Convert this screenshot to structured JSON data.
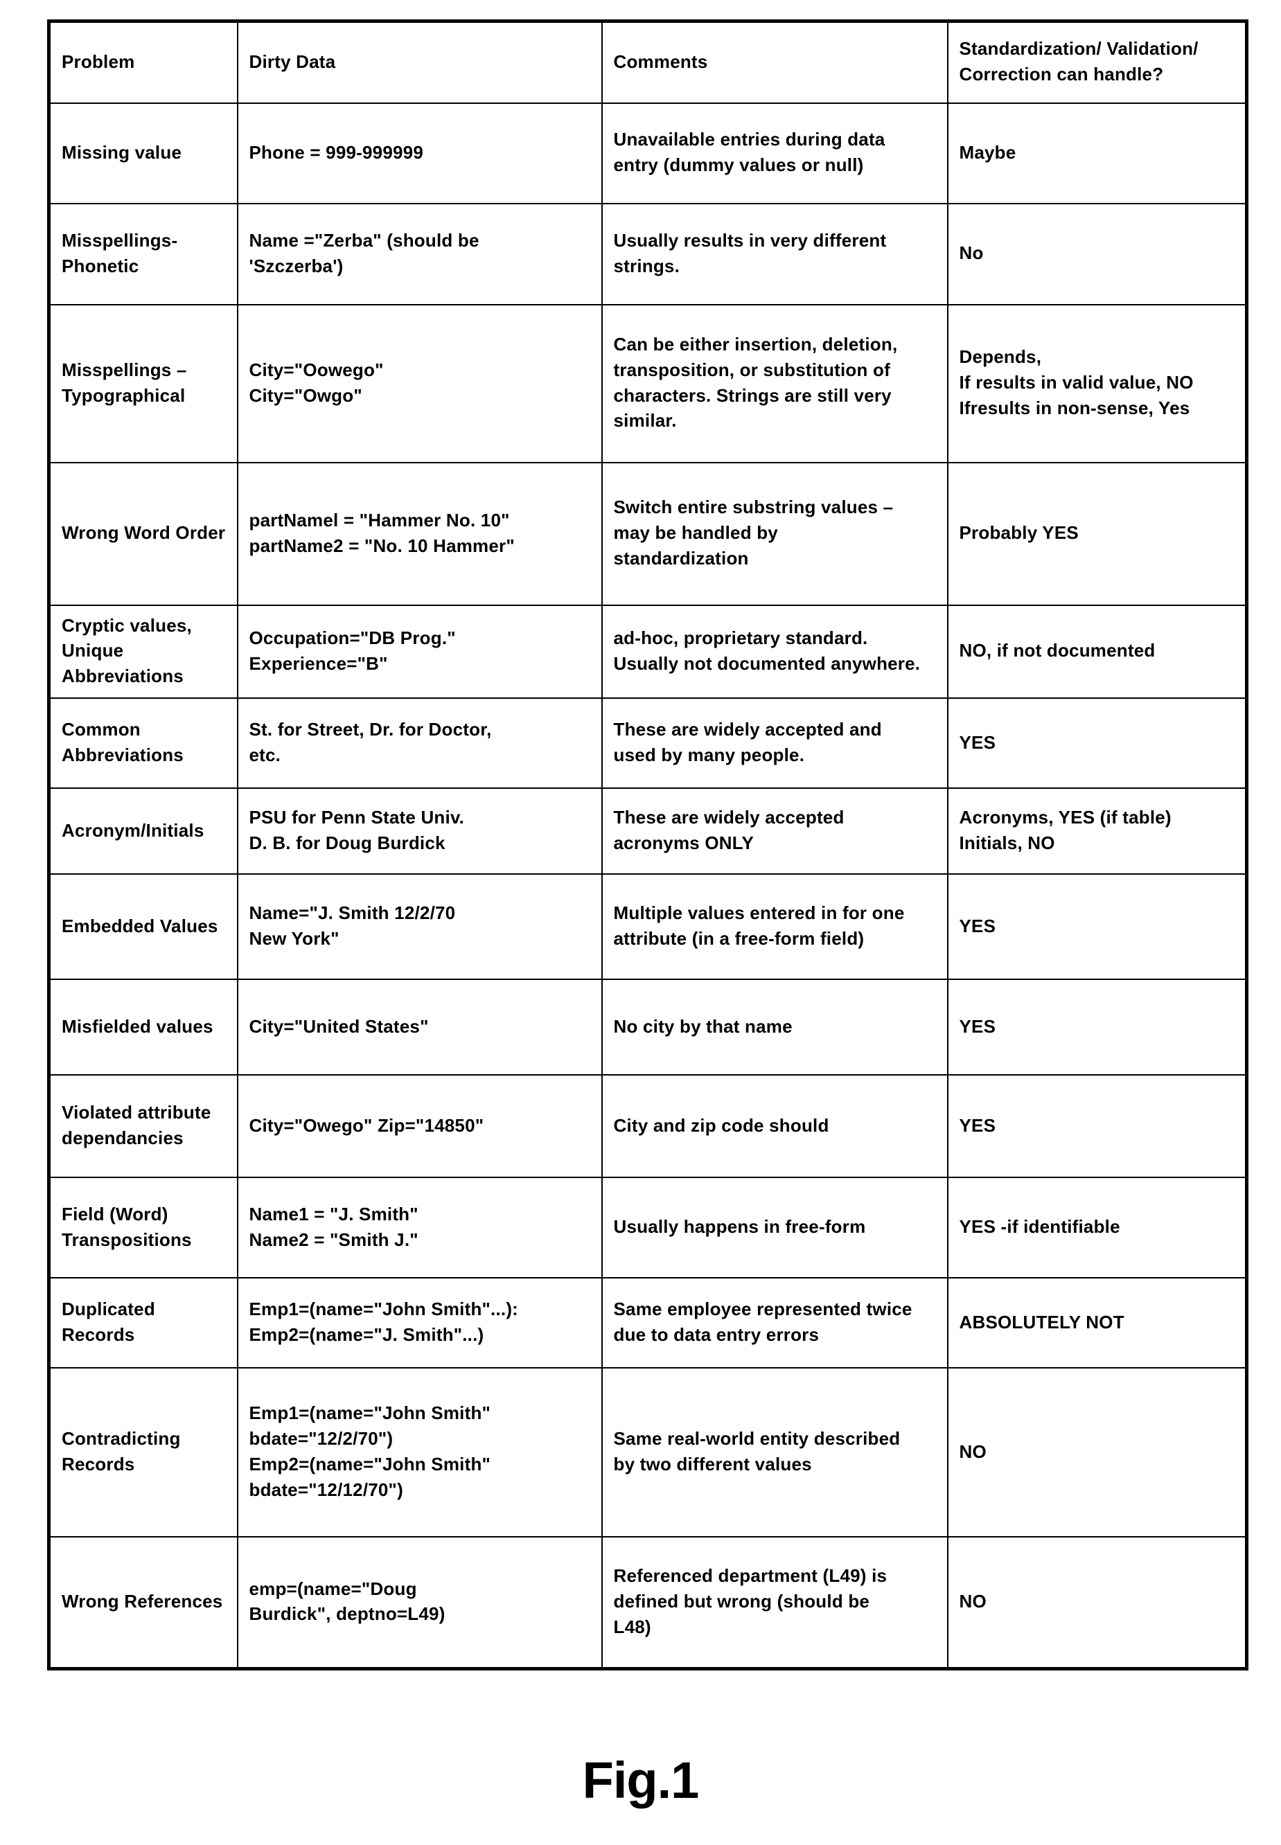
{
  "figure": {
    "caption": "Fig.1"
  },
  "table": {
    "columns": [
      "Problem",
      "Dirty Data",
      "Comments",
      "Standardization/ Validation/\nCorrection can handle?"
    ],
    "rows": [
      {
        "problem": "Missing value",
        "dirty_data": "Phone = 999-999999",
        "comments": "Unavailable entries during data\nentry (dummy values or null)",
        "handle": "Maybe"
      },
      {
        "problem": "Misspellings-\nPhonetic",
        "dirty_data": "Name =\"Zerba\" (should be\n'Szczerba')",
        "comments": "Usually results in very different\nstrings.",
        "handle": "No"
      },
      {
        "problem": "Misspellings –\nTypographical",
        "dirty_data": "City=\"Oowego\"\nCity=\"Owgo\"",
        "comments": "Can be either insertion, deletion,\ntransposition, or substitution of\ncharacters. Strings are still very\nsimilar.",
        "handle": "Depends,\nIf results in valid value, NO\nIfresults in non-sense, Yes"
      },
      {
        "problem": "Wrong Word Order",
        "dirty_data": "partNamel = \"Hammer No. 10\"\npartName2 = \"No. 10 Hammer\"",
        "comments": "Switch entire substring values –\nmay be handled by\nstandardization",
        "handle": "Probably YES"
      },
      {
        "problem": "Cryptic values,\nUnique Abbreviations",
        "dirty_data": "Occupation=\"DB Prog.\"\nExperience=\"B\"",
        "comments": "ad-hoc, proprietary standard.\nUsually not documented anywhere.",
        "handle": "NO, if not documented"
      },
      {
        "problem": "Common\nAbbreviations",
        "dirty_data": "St. for Street, Dr. for Doctor,\netc.",
        "comments": "These are widely accepted and\nused by many people.",
        "handle": "YES"
      },
      {
        "problem": "Acronym/Initials",
        "dirty_data": "PSU for Penn State Univ.\nD. B. for Doug Burdick",
        "comments": "These are widely accepted\nacronyms ONLY",
        "handle": "Acronyms, YES (if table)\nInitials, NO"
      },
      {
        "problem": "Embedded Values",
        "dirty_data": "Name=\"J. Smith 12/2/70\nNew York\"",
        "comments": "Multiple values entered in for one\nattribute (in a free-form field)",
        "handle": "YES"
      },
      {
        "problem": "Misfielded values",
        "dirty_data": "City=\"United States\"",
        "comments": "No city by that name",
        "handle": "YES"
      },
      {
        "problem": "Violated attribute\ndependancies",
        "dirty_data": "City=\"Owego\" Zip=\"14850\"",
        "comments": "City and zip code should",
        "handle": "YES"
      },
      {
        "problem": "Field (Word)\nTranspositions",
        "dirty_data": "Name1 = \"J. Smith\"\nName2 = \"Smith J.\"",
        "comments": "Usually happens in free-form",
        "handle": "YES -if identifiable"
      },
      {
        "problem": "Duplicated Records",
        "dirty_data": "Emp1=(name=\"John Smith\"...):\nEmp2=(name=\"J. Smith\"...)",
        "comments": "Same employee represented twice\ndue to data entry errors",
        "handle": "ABSOLUTELY NOT"
      },
      {
        "problem": "Contradicting Records",
        "dirty_data": "Emp1=(name=\"John Smith\"\nbdate=\"12/2/70\")\nEmp2=(name=\"John Smith\"\nbdate=\"12/12/70\")",
        "comments": "Same real-world entity described\nby two different values",
        "handle": "NO"
      },
      {
        "problem": "Wrong References",
        "dirty_data": "emp=(name=\"Doug\nBurdick\", deptno=L49)",
        "comments": "Referenced department (L49) is\ndefined but wrong (should be\nL48)",
        "handle": "NO"
      }
    ]
  }
}
